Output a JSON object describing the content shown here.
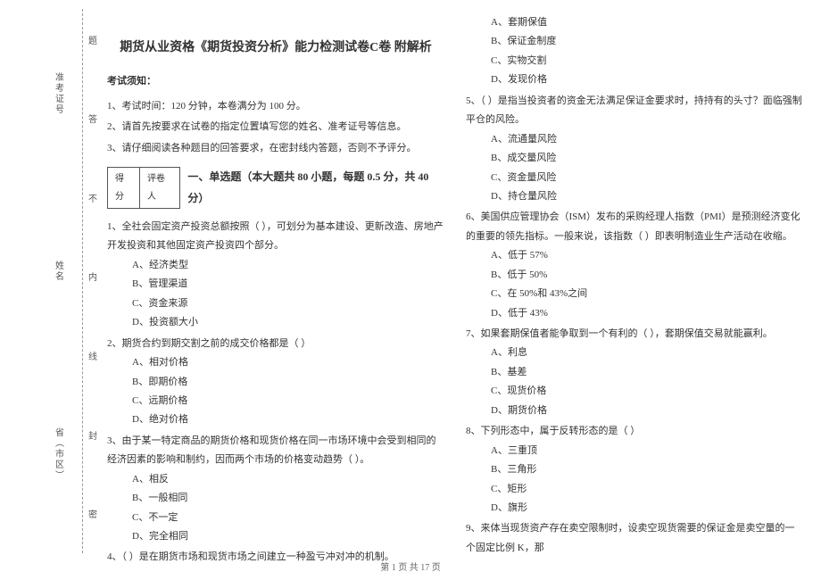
{
  "side": {
    "items": [
      "省（市区）",
      "姓名",
      "准考证号"
    ],
    "binding": [
      "密",
      "封",
      "线",
      "内",
      "不",
      "答",
      "题"
    ]
  },
  "title": "期货从业资格《期货投资分析》能力检测试卷C卷 附解析",
  "notice": {
    "heading": "考试须知：",
    "lines": [
      "1、考试时间：120 分钟，本卷满分为 100 分。",
      "2、请首先按要求在试卷的指定位置填写您的姓名、准考证号等信息。",
      "3、请仔细阅读各种题目的回答要求，在密封线内答题，否则不予评分。"
    ]
  },
  "score": {
    "c1": "得分",
    "c2": "评卷人"
  },
  "section": "一、单选题（本大题共 80 小题，每题 0.5 分，共 40 分）",
  "q1": {
    "stem": "1、全社会固定资产投资总额按照（    ），可划分为基本建设、更新改造、房地产开发投资和其他固定资产投资四个部分。",
    "a": "A、经济类型",
    "b": "B、管理渠道",
    "c": "C、资金来源",
    "d": "D、投资额大小"
  },
  "q2": {
    "stem": "2、期货合约到期交割之前的成交价格都是（    ）",
    "a": "A、相对价格",
    "b": "B、即期价格",
    "c": "C、远期价格",
    "d": "D、绝对价格"
  },
  "q3": {
    "stem": "3、由于某一特定商品的期货价格和现货价格在同一市场环境中会受到相同的经济因素的影响和制约，因而两个市场的价格变动趋势（    ）。",
    "a": "A、相反",
    "b": "B、一般相同",
    "c": "C、不一定",
    "d": "D、完全相同"
  },
  "q4": {
    "stem": "4、（    ）是在期货市场和现货市场之间建立一种盈亏冲对冲的机制。",
    "a": "A、套期保值",
    "b": "B、保证金制度",
    "c": "C、实物交割",
    "d": "D、发现价格"
  },
  "q5": {
    "stem": "5、（    ）是指当投资者的资金无法满足保证金要求时，持持有的头寸？面临强制平仓的风险。",
    "a": "A、流通量风险",
    "b": "B、成交量风险",
    "c": "C、资金量风险",
    "d": "D、持仓量风险"
  },
  "q6": {
    "stem": "6、美国供应管理协会（ISM）发布的采购经理人指数（PMI）是预测经济变化的重要的领先指标。一般来说，该指数（    ）即表明制造业生产活动在收缩。",
    "a": "A、低于 57%",
    "b": "B、低于 50%",
    "c": "C、在 50%和 43%之间",
    "d": "D、低于 43%"
  },
  "q7": {
    "stem": "7、如果套期保值者能争取到一个有利的（    ），套期保值交易就能赢利。",
    "a": "A、利息",
    "b": "B、基差",
    "c": "C、现货价格",
    "d": "D、期货价格"
  },
  "q8": {
    "stem": "8、下列形态中，属于反转形态的是（    ）",
    "a": "A、三重顶",
    "b": "B、三角形",
    "c": "C、矩形",
    "d": "D、旗形"
  },
  "q9": {
    "stem": "9、来体当现货资产存在卖空限制时，设卖空现货需要的保证金是卖空量的一个固定比例 K，那"
  },
  "footer": "第 1 页 共 17 页"
}
